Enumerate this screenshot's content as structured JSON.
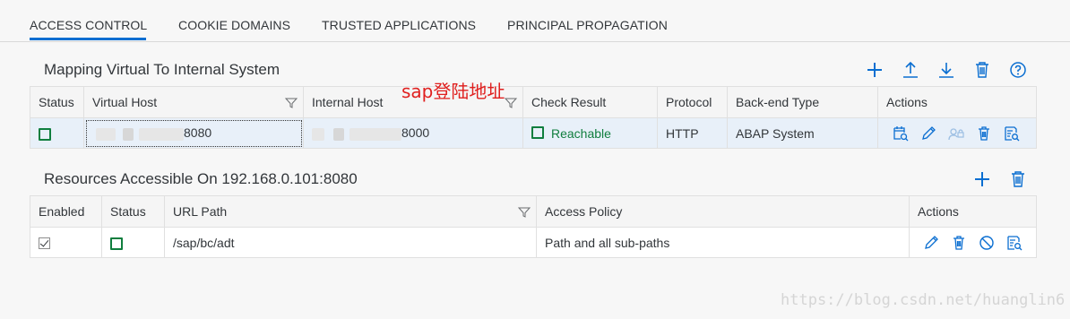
{
  "tabs": [
    "ACCESS CONTROL",
    "COOKIE DOMAINS",
    "TRUSTED APPLICATIONS",
    "PRINCIPAL PROPAGATION"
  ],
  "mapping": {
    "title": "Mapping Virtual To Internal System",
    "toolbar_icons": [
      "add-icon",
      "upload-icon",
      "download-icon",
      "delete-icon",
      "help-icon"
    ],
    "columns": [
      "Status",
      "Virtual Host",
      "Internal Host",
      "Check Result",
      "Protocol",
      "Back-end Type",
      "Actions"
    ],
    "row": {
      "virtual_host_suffix": "8080",
      "internal_host_suffix": "8000",
      "check_result": "Reachable",
      "protocol": "HTTP",
      "backend_type": "ABAP System"
    },
    "row_actions": [
      "check-availability-icon",
      "edit-icon",
      "principal-type-icon",
      "delete-icon",
      "details-icon"
    ]
  },
  "resources": {
    "title": "Resources Accessible On 192.168.0.101:8080",
    "toolbar_icons": [
      "add-icon",
      "delete-icon"
    ],
    "columns": [
      "Enabled",
      "Status",
      "URL Path",
      "Access Policy",
      "Actions"
    ],
    "row": {
      "url_path": "/sap/bc/adt",
      "access_policy": "Path and all sub-paths"
    },
    "row_actions": [
      "edit-icon",
      "delete-icon",
      "deactivate-icon",
      "details-icon"
    ]
  },
  "annotation": "sap登陆地址",
  "watermark": "https://blog.csdn.net/huanglin6",
  "colors": {
    "accent": "#0a6ed1",
    "icon": "#0a6ed1",
    "positive": "#107e3e",
    "annotation": "#e0201f"
  }
}
